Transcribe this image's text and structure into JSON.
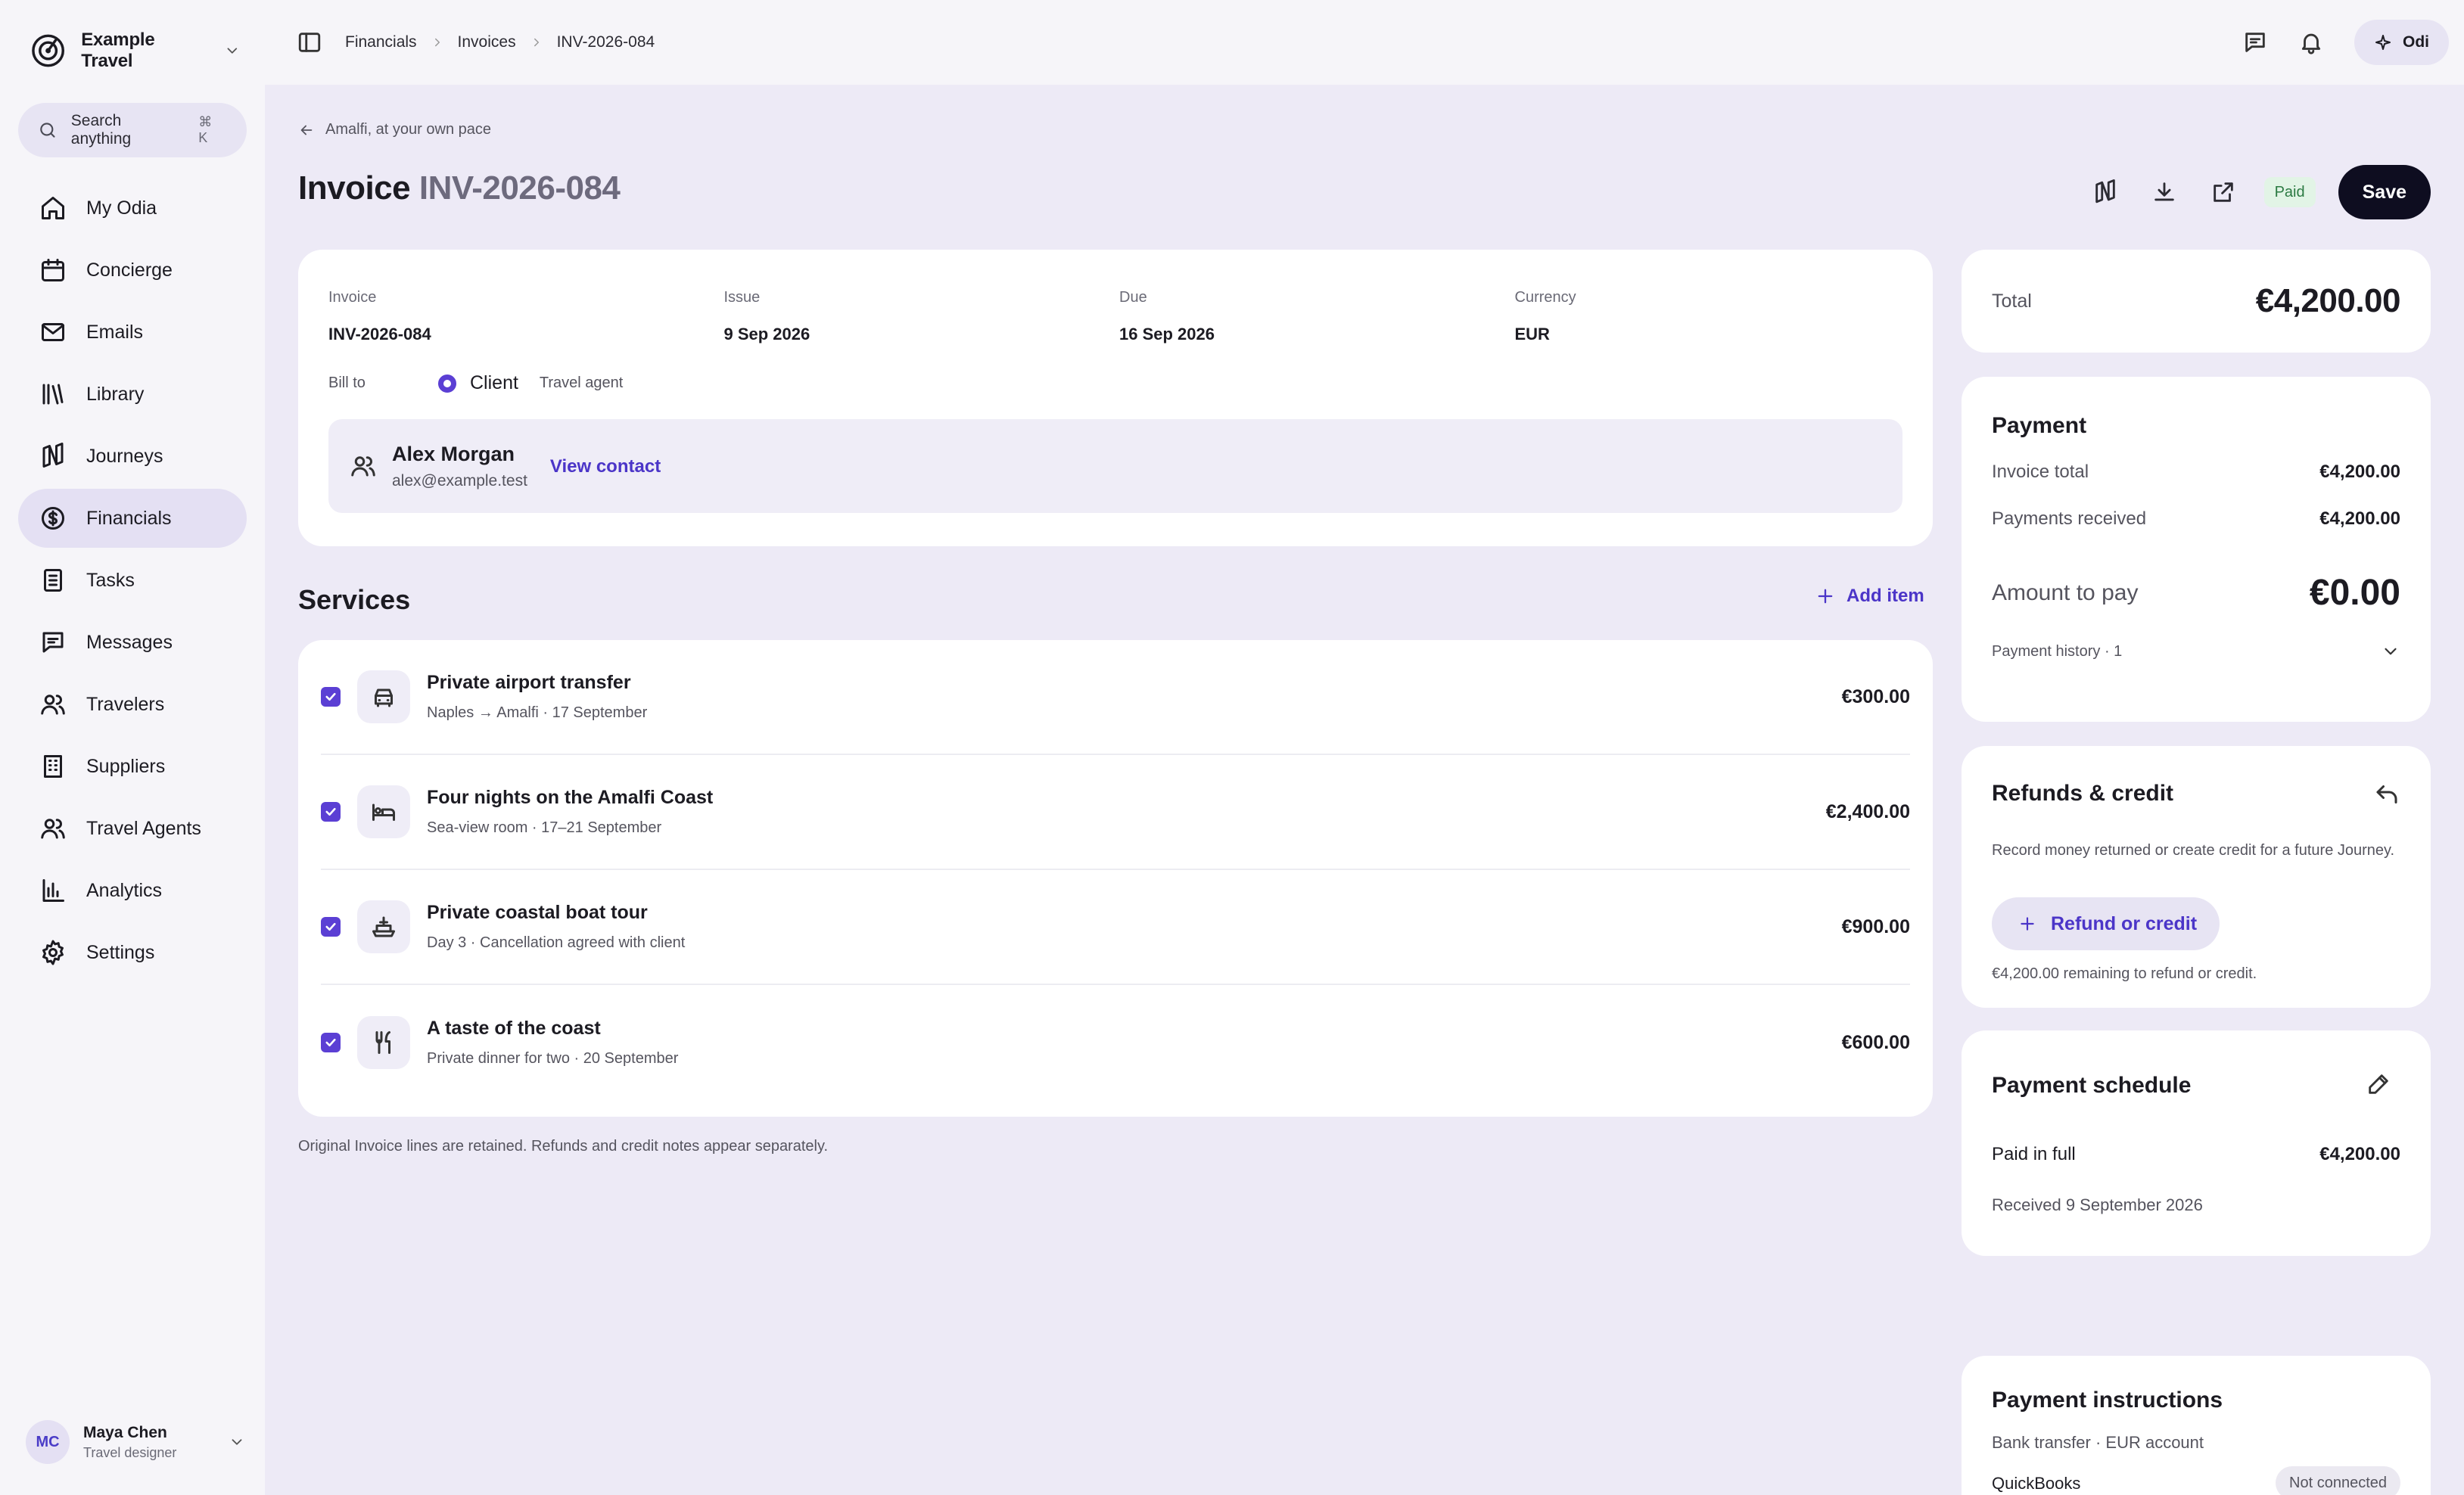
{
  "brand": {
    "name": "Example Travel"
  },
  "search": {
    "label": "Search anything",
    "shortcut": "⌘ K"
  },
  "nav": {
    "items": [
      {
        "label": "My Odia",
        "icon": "home-icon"
      },
      {
        "label": "Concierge",
        "icon": "calendar-icon"
      },
      {
        "label": "Emails",
        "icon": "mail-icon"
      },
      {
        "label": "Library",
        "icon": "library-icon"
      },
      {
        "label": "Journeys",
        "icon": "map-icon"
      },
      {
        "label": "Financials",
        "icon": "dollar-icon",
        "active": true
      },
      {
        "label": "Tasks",
        "icon": "tasks-icon"
      },
      {
        "label": "Messages",
        "icon": "message-icon"
      },
      {
        "label": "Travelers",
        "icon": "users-icon"
      },
      {
        "label": "Suppliers",
        "icon": "building-icon"
      },
      {
        "label": "Travel Agents",
        "icon": "users-icon"
      },
      {
        "label": "Analytics",
        "icon": "chart-icon"
      },
      {
        "label": "Settings",
        "icon": "gear-icon"
      }
    ]
  },
  "user": {
    "initials": "MC",
    "name": "Maya Chen",
    "role": "Travel designer"
  },
  "breadcrumb": [
    "Financials",
    "Invoices",
    "INV-2026-084"
  ],
  "topbar": {
    "assistant_label": "Odi"
  },
  "page": {
    "back_label": "Amalfi, at your own pace",
    "title_prefix": "Invoice",
    "title_number": "INV-2026-084",
    "status": "Paid",
    "save_label": "Save"
  },
  "invoice": {
    "meta": [
      {
        "label": "Invoice",
        "value": "INV-2026-084"
      },
      {
        "label": "Issue",
        "value": "9 Sep 2026"
      },
      {
        "label": "Due",
        "value": "16 Sep 2026"
      },
      {
        "label": "Currency",
        "value": "EUR"
      }
    ],
    "bill_to_label": "Bill to",
    "bill_to_selected": "Client",
    "bill_to_other": "Travel agent",
    "contact": {
      "name": "Alex Morgan",
      "email": "alex@example.test",
      "link": "View contact"
    }
  },
  "services": {
    "title": "Services",
    "add_label": "Add item",
    "items": [
      {
        "name": "Private airport transfer",
        "detail": "Naples → Amalfi · 17 September",
        "price": "€300.00",
        "icon": "car-icon",
        "checked": true
      },
      {
        "name": "Four nights on the Amalfi Coast",
        "detail": "Sea-view room · 17–21 September",
        "price": "€2,400.00",
        "icon": "bed-icon",
        "checked": true
      },
      {
        "name": "Private coastal boat tour",
        "detail": "Day 3 · Cancellation agreed with client",
        "price": "€900.00",
        "icon": "boat-icon",
        "checked": true
      },
      {
        "name": "A taste of the coast",
        "detail": "Private dinner for two · 20 September",
        "price": "€600.00",
        "icon": "cutlery-icon",
        "checked": true
      }
    ],
    "footnote": "Original Invoice lines are retained. Refunds and credit notes appear separately."
  },
  "total": {
    "label": "Total",
    "value": "€4,200.00"
  },
  "payment": {
    "title": "Payment",
    "invoice_total_label": "Invoice total",
    "invoice_total": "€4,200.00",
    "received_label": "Payments received",
    "received": "€4,200.00",
    "amount_label": "Amount to pay",
    "amount": "€0.00",
    "history_label": "Payment history · 1"
  },
  "refunds": {
    "title": "Refunds & credit",
    "description": "Record money returned or create credit for a future Journey.",
    "button_label": "Refund or credit",
    "remaining": "€4,200.00 remaining to refund or credit."
  },
  "schedule": {
    "title": "Payment schedule",
    "status_label": "Paid in full",
    "amount": "€4,200.00",
    "received": "Received 9 September 2026"
  },
  "instructions": {
    "title": "Payment instructions",
    "method": "Bank transfer · EUR account",
    "integration_label": "QuickBooks",
    "integration_status": "Not connected"
  },
  "colors": {
    "accent": "#5b3fd4",
    "link": "#4b35c8",
    "paid_bg": "#e2f4e6",
    "paid_text": "#2c7a43",
    "primary_button": "#0e0d20"
  }
}
